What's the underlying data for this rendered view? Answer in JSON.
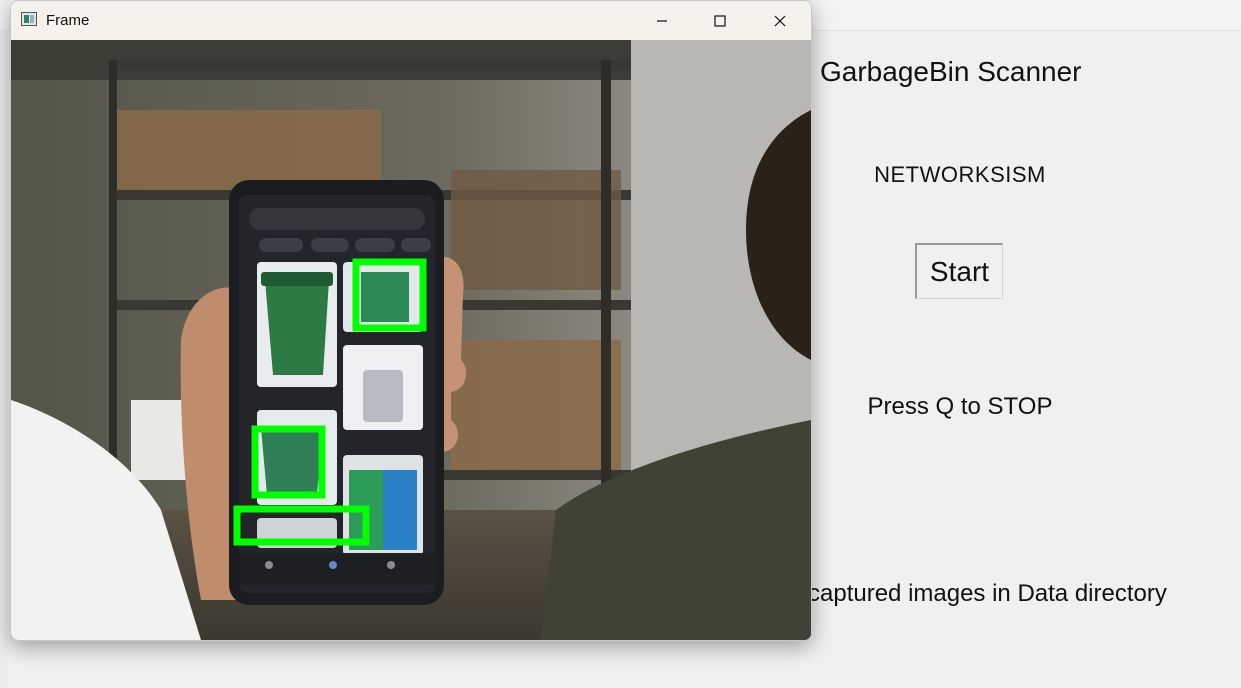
{
  "app": {
    "title": "GarbageBin Scanner",
    "subtitle": "NETWORKSISM",
    "start_label": "Start",
    "instruction": "Press Q to STOP",
    "info": "captured images in Data directory"
  },
  "frame_window": {
    "title": "Frame",
    "controls": [
      "minimize",
      "maximize",
      "close"
    ]
  },
  "video": {
    "detection_color": "#00ff00",
    "detections_count": 3
  },
  "icons": {
    "app_icon": "opencv-window-icon",
    "minimize": "minimize-icon",
    "maximize": "maximize-icon",
    "close": "close-icon"
  }
}
